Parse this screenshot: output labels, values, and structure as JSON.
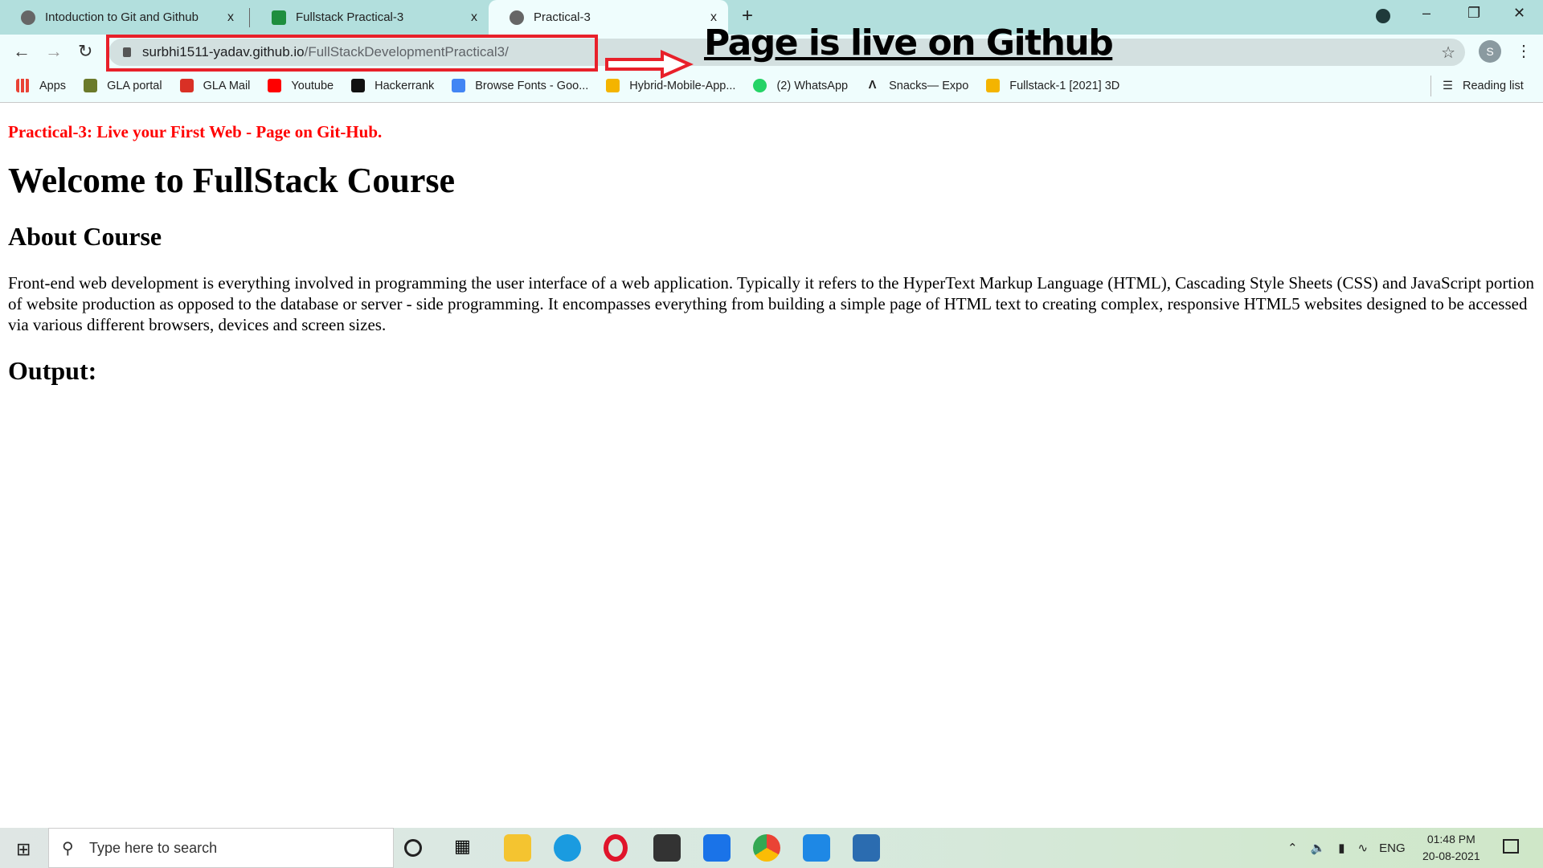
{
  "browser": {
    "tabs": [
      {
        "label": "Intoduction to Git and Github",
        "icon": "globe-icon"
      },
      {
        "label": "Fullstack Practical-3",
        "icon": "classroom-icon"
      },
      {
        "label": "Practical-3",
        "icon": "globe-icon",
        "active": true
      }
    ],
    "close_glyph": "x",
    "new_tab_glyph": "+",
    "url_host": "surbhi1511-yadav.github.io",
    "url_path": "/FullStackDevelopmentPractical3/",
    "profile_initial": "S",
    "bookmarks": [
      {
        "label": "Apps",
        "color": "#e94235"
      },
      {
        "label": "GLA portal",
        "color": "#6b7a2a"
      },
      {
        "label": "GLA Mail",
        "color": "#d93025"
      },
      {
        "label": "Youtube",
        "color": "#ff0000"
      },
      {
        "label": "Hackerrank",
        "color": "#111111"
      },
      {
        "label": "Browse Fonts - Goo...",
        "color": "#4285f4"
      },
      {
        "label": "Hybrid-Mobile-App...",
        "color": "#f4b400"
      },
      {
        "label": "(2) WhatsApp",
        "color": "#25d366"
      },
      {
        "label": "Snacks— Expo",
        "color": "#000000"
      },
      {
        "label": "Fullstack-1 [2021] 3D",
        "color": "#f4b400"
      }
    ],
    "reading_list": "Reading list"
  },
  "annotation": {
    "text": "Page is live on Github",
    "color": "#e8202a"
  },
  "page": {
    "practical": "Practical-3: Live your First Web - Page on Git-Hub.",
    "h1": "Welcome to FullStack Course",
    "h2": "About Course",
    "paragraph": "Front-end web development is everything involved in programming the user interface of a web application. Typically it refers to the HyperText Markup Language (HTML), Cascading Style Sheets (CSS) and JavaScript portion of website production as opposed to the database or server - side programming. It encompasses everything from building a simple page of HTML text to creating complex, responsive HTML5 websites designed to be accessed via various different browsers, devices and screen sizes.",
    "output": "Output:"
  },
  "taskbar": {
    "search_placeholder": "Type here to search",
    "lang": "ENG",
    "time": "01:48 PM",
    "date": "20-08-2021"
  }
}
